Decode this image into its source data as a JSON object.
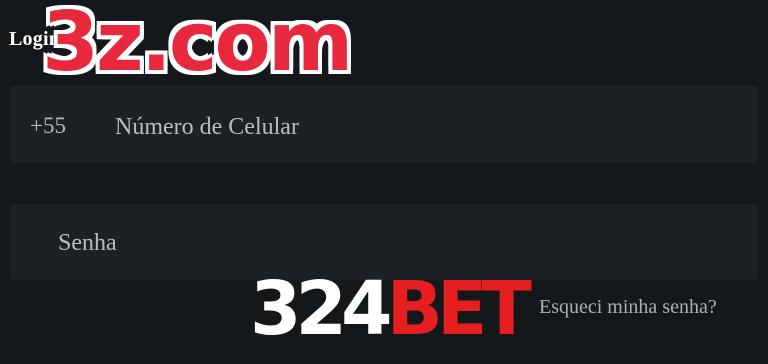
{
  "login": {
    "title": "Login"
  },
  "phone_field": {
    "country_code": "+55",
    "placeholder": "Número de Celular",
    "value": ""
  },
  "password_field": {
    "placeholder": "Senha",
    "value": ""
  },
  "forgot_password": {
    "label": "Esqueci minha senha?"
  },
  "watermark": {
    "top": "3z.com",
    "bottom_white": "324",
    "bottom_red": "BET"
  },
  "colors": {
    "background": "#15181b",
    "field_background": "#1d2126",
    "watermark_red": "#e8283c",
    "bet_red": "#e51f1f",
    "link_color": "#aab0b8"
  }
}
